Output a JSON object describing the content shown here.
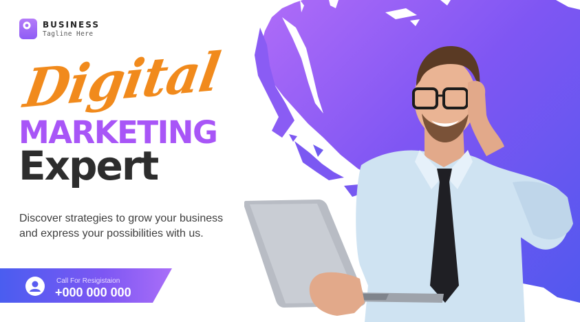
{
  "brand": {
    "name": "BUSINESS",
    "tagline": "Tagline Here"
  },
  "headline": {
    "script": "Digital",
    "line1": "MARKETING",
    "line2": "Expert"
  },
  "description": {
    "line1": "Discover strategies to grow your business",
    "line2": "and express your possibilities with us."
  },
  "cta": {
    "label": "Call For Resigistaion",
    "phone": "+000 000 000"
  },
  "colors": {
    "accent_purple": "#a855f7",
    "deep_purple": "#6d5ef0",
    "orange": "#f18a1c",
    "dark_text": "#2d2d2d"
  },
  "icons": {
    "logo": "brand-logo-icon",
    "user": "user-icon"
  }
}
